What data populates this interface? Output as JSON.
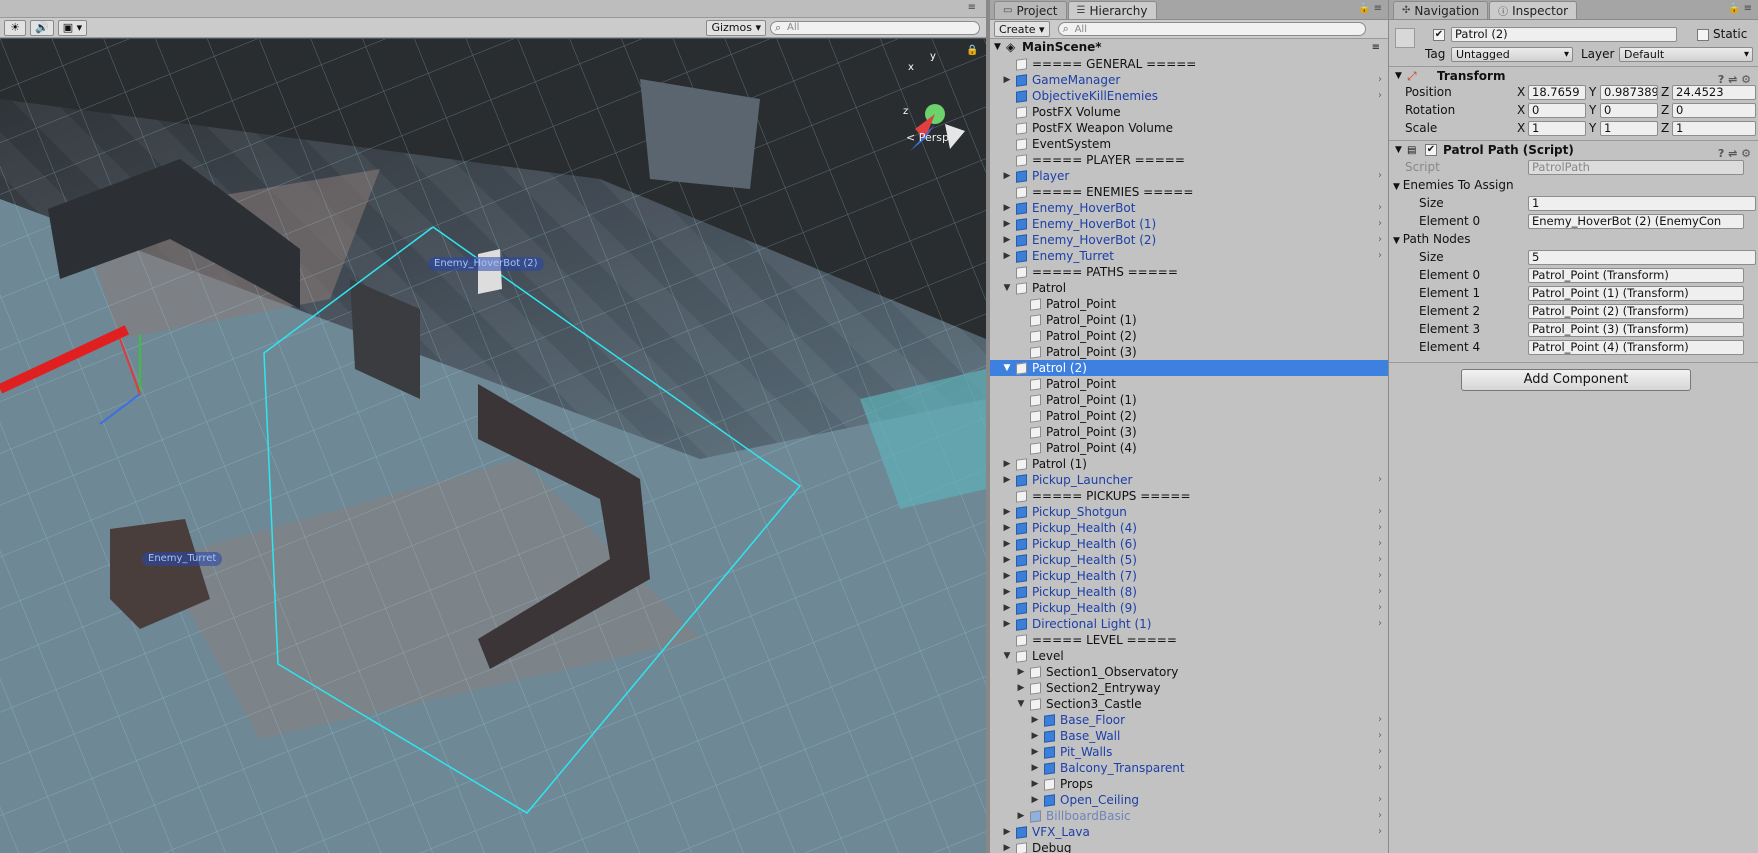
{
  "scene_view": {
    "gizmos_label": "Gizmos",
    "search_placeholder": "All",
    "persp_label": "Persp",
    "labels": {
      "hoverbot": "Enemy_HoverBot (2)",
      "turret": "Enemy_Turret"
    },
    "axis": {
      "x": "x",
      "y": "y",
      "z": "z"
    }
  },
  "hierarchy": {
    "tabs": [
      {
        "label": "Project"
      },
      {
        "label": "Hierarchy"
      }
    ],
    "create_label": "Create",
    "search_placeholder": "All",
    "scene_name": "MainScene*",
    "rows": [
      {
        "label": "===== GENERAL =====",
        "depth": 0,
        "arrow": "",
        "kind": "plain",
        "chev": false
      },
      {
        "label": "GameManager",
        "depth": 0,
        "arrow": "▶",
        "kind": "prefab",
        "chev": true
      },
      {
        "label": "ObjectiveKillEnemies",
        "depth": 0,
        "arrow": "",
        "kind": "prefab",
        "chev": true
      },
      {
        "label": "PostFX Volume",
        "depth": 0,
        "arrow": "",
        "kind": "plain",
        "chev": false
      },
      {
        "label": "PostFX Weapon Volume",
        "depth": 0,
        "arrow": "",
        "kind": "plain",
        "chev": false
      },
      {
        "label": "EventSystem",
        "depth": 0,
        "arrow": "",
        "kind": "plain",
        "chev": false
      },
      {
        "label": "===== PLAYER =====",
        "depth": 0,
        "arrow": "",
        "kind": "plain",
        "chev": false
      },
      {
        "label": "Player",
        "depth": 0,
        "arrow": "▶",
        "kind": "prefab",
        "chev": true
      },
      {
        "label": "===== ENEMIES =====",
        "depth": 0,
        "arrow": "",
        "kind": "plain",
        "chev": false
      },
      {
        "label": "Enemy_HoverBot",
        "depth": 0,
        "arrow": "▶",
        "kind": "prefab",
        "chev": true
      },
      {
        "label": "Enemy_HoverBot (1)",
        "depth": 0,
        "arrow": "▶",
        "kind": "prefab",
        "chev": true
      },
      {
        "label": "Enemy_HoverBot (2)",
        "depth": 0,
        "arrow": "▶",
        "kind": "prefab",
        "chev": true
      },
      {
        "label": "Enemy_Turret",
        "depth": 0,
        "arrow": "▶",
        "kind": "prefab",
        "chev": true
      },
      {
        "label": "===== PATHS =====",
        "depth": 0,
        "arrow": "",
        "kind": "plain",
        "chev": false
      },
      {
        "label": "Patrol",
        "depth": 0,
        "arrow": "▼",
        "kind": "plain",
        "chev": false
      },
      {
        "label": "Patrol_Point",
        "depth": 1,
        "arrow": "",
        "kind": "plain",
        "chev": false
      },
      {
        "label": "Patrol_Point (1)",
        "depth": 1,
        "arrow": "",
        "kind": "plain",
        "chev": false
      },
      {
        "label": "Patrol_Point (2)",
        "depth": 1,
        "arrow": "",
        "kind": "plain",
        "chev": false
      },
      {
        "label": "Patrol_Point (3)",
        "depth": 1,
        "arrow": "",
        "kind": "plain",
        "chev": false
      },
      {
        "label": "Patrol (2)",
        "depth": 0,
        "arrow": "▼",
        "kind": "selected",
        "chev": false
      },
      {
        "label": "Patrol_Point",
        "depth": 1,
        "arrow": "",
        "kind": "plain",
        "chev": false
      },
      {
        "label": "Patrol_Point (1)",
        "depth": 1,
        "arrow": "",
        "kind": "plain",
        "chev": false
      },
      {
        "label": "Patrol_Point (2)",
        "depth": 1,
        "arrow": "",
        "kind": "plain",
        "chev": false
      },
      {
        "label": "Patrol_Point (3)",
        "depth": 1,
        "arrow": "",
        "kind": "plain",
        "chev": false
      },
      {
        "label": "Patrol_Point (4)",
        "depth": 1,
        "arrow": "",
        "kind": "plain",
        "chev": false
      },
      {
        "label": "Patrol (1)",
        "depth": 0,
        "arrow": "▶",
        "kind": "plain",
        "chev": false
      },
      {
        "label": "Pickup_Launcher",
        "depth": 0,
        "arrow": "▶",
        "kind": "prefab",
        "chev": true
      },
      {
        "label": "===== PICKUPS =====",
        "depth": 0,
        "arrow": "",
        "kind": "plain",
        "chev": false
      },
      {
        "label": "Pickup_Shotgun",
        "depth": 0,
        "arrow": "▶",
        "kind": "prefab",
        "chev": true
      },
      {
        "label": "Pickup_Health (4)",
        "depth": 0,
        "arrow": "▶",
        "kind": "prefab",
        "chev": true
      },
      {
        "label": "Pickup_Health (6)",
        "depth": 0,
        "arrow": "▶",
        "kind": "prefab",
        "chev": true
      },
      {
        "label": "Pickup_Health (5)",
        "depth": 0,
        "arrow": "▶",
        "kind": "prefab",
        "chev": true
      },
      {
        "label": "Pickup_Health (7)",
        "depth": 0,
        "arrow": "▶",
        "kind": "prefab",
        "chev": true
      },
      {
        "label": "Pickup_Health (8)",
        "depth": 0,
        "arrow": "▶",
        "kind": "prefab",
        "chev": true
      },
      {
        "label": "Pickup_Health (9)",
        "depth": 0,
        "arrow": "▶",
        "kind": "prefab",
        "chev": true
      },
      {
        "label": "Directional Light (1)",
        "depth": 0,
        "arrow": "▶",
        "kind": "prefab",
        "chev": true
      },
      {
        "label": "===== LEVEL =====",
        "depth": 0,
        "arrow": "",
        "kind": "plain",
        "chev": false
      },
      {
        "label": "Level",
        "depth": 0,
        "arrow": "▼",
        "kind": "plain",
        "chev": false
      },
      {
        "label": "Section1_Observatory",
        "depth": 1,
        "arrow": "▶",
        "kind": "plain",
        "chev": false
      },
      {
        "label": "Section2_Entryway",
        "depth": 1,
        "arrow": "▶",
        "kind": "plain",
        "chev": false
      },
      {
        "label": "Section3_Castle",
        "depth": 1,
        "arrow": "▼",
        "kind": "plain",
        "chev": false
      },
      {
        "label": "Base_Floor",
        "depth": 2,
        "arrow": "▶",
        "kind": "prefab",
        "chev": true
      },
      {
        "label": "Base_Wall",
        "depth": 2,
        "arrow": "▶",
        "kind": "prefab",
        "chev": true
      },
      {
        "label": "Pit_Walls",
        "depth": 2,
        "arrow": "▶",
        "kind": "prefab",
        "chev": true
      },
      {
        "label": "Balcony_Transparent",
        "depth": 2,
        "arrow": "▶",
        "kind": "prefab",
        "chev": true
      },
      {
        "label": "Props",
        "depth": 2,
        "arrow": "▶",
        "kind": "plain",
        "chev": false
      },
      {
        "label": "Open_Ceiling",
        "depth": 2,
        "arrow": "▶",
        "kind": "prefab",
        "chev": true
      },
      {
        "label": "BillboardBasic",
        "depth": 1,
        "arrow": "▶",
        "kind": "faded",
        "chev": true
      },
      {
        "label": "VFX_Lava",
        "depth": 0,
        "arrow": "▶",
        "kind": "prefab",
        "chev": true
      },
      {
        "label": "Debug",
        "depth": 0,
        "arrow": "▶",
        "kind": "plain",
        "chev": false
      }
    ]
  },
  "inspector": {
    "tabs": [
      {
        "label": "Navigation"
      },
      {
        "label": "Inspector"
      }
    ],
    "object_name": "Patrol (2)",
    "static_label": "Static",
    "tag_label": "Tag",
    "tag_value": "Untagged",
    "layer_label": "Layer",
    "layer_value": "Default",
    "transform": {
      "title": "Transform",
      "position_label": "Position",
      "position": {
        "x": "18.7659",
        "y": "0.9873898",
        "z": "24.4523"
      },
      "rotation_label": "Rotation",
      "rotation": {
        "x": "0",
        "y": "0",
        "z": "0"
      },
      "scale_label": "Scale",
      "scale": {
        "x": "1",
        "y": "1",
        "z": "1"
      },
      "axis": {
        "x": "X",
        "y": "Y",
        "z": "Z"
      }
    },
    "patrol_path": {
      "title": "Patrol Path (Script)",
      "script_label": "Script",
      "script_value": "PatrolPath",
      "enemies_label": "Enemies To Assign",
      "enemies_size_label": "Size",
      "enemies_size": "1",
      "enemies": [
        {
          "label": "Element 0",
          "value": "Enemy_HoverBot (2) (EnemyCon"
        }
      ],
      "nodes_label": "Path Nodes",
      "nodes_size_label": "Size",
      "nodes_size": "5",
      "nodes": [
        {
          "label": "Element 0",
          "value": "Patrol_Point (Transform)"
        },
        {
          "label": "Element 1",
          "value": "Patrol_Point (1) (Transform)"
        },
        {
          "label": "Element 2",
          "value": "Patrol_Point (2) (Transform)"
        },
        {
          "label": "Element 3",
          "value": "Patrol_Point (3) (Transform)"
        },
        {
          "label": "Element 4",
          "value": "Patrol_Point (4) (Transform)"
        }
      ]
    },
    "add_component_label": "Add Component"
  },
  "colors": {
    "selection": "#3d80df",
    "prefab_text": "#1c3fa8",
    "path_line": "#2ee6f0",
    "panel_bg": "#c2c2c2"
  }
}
